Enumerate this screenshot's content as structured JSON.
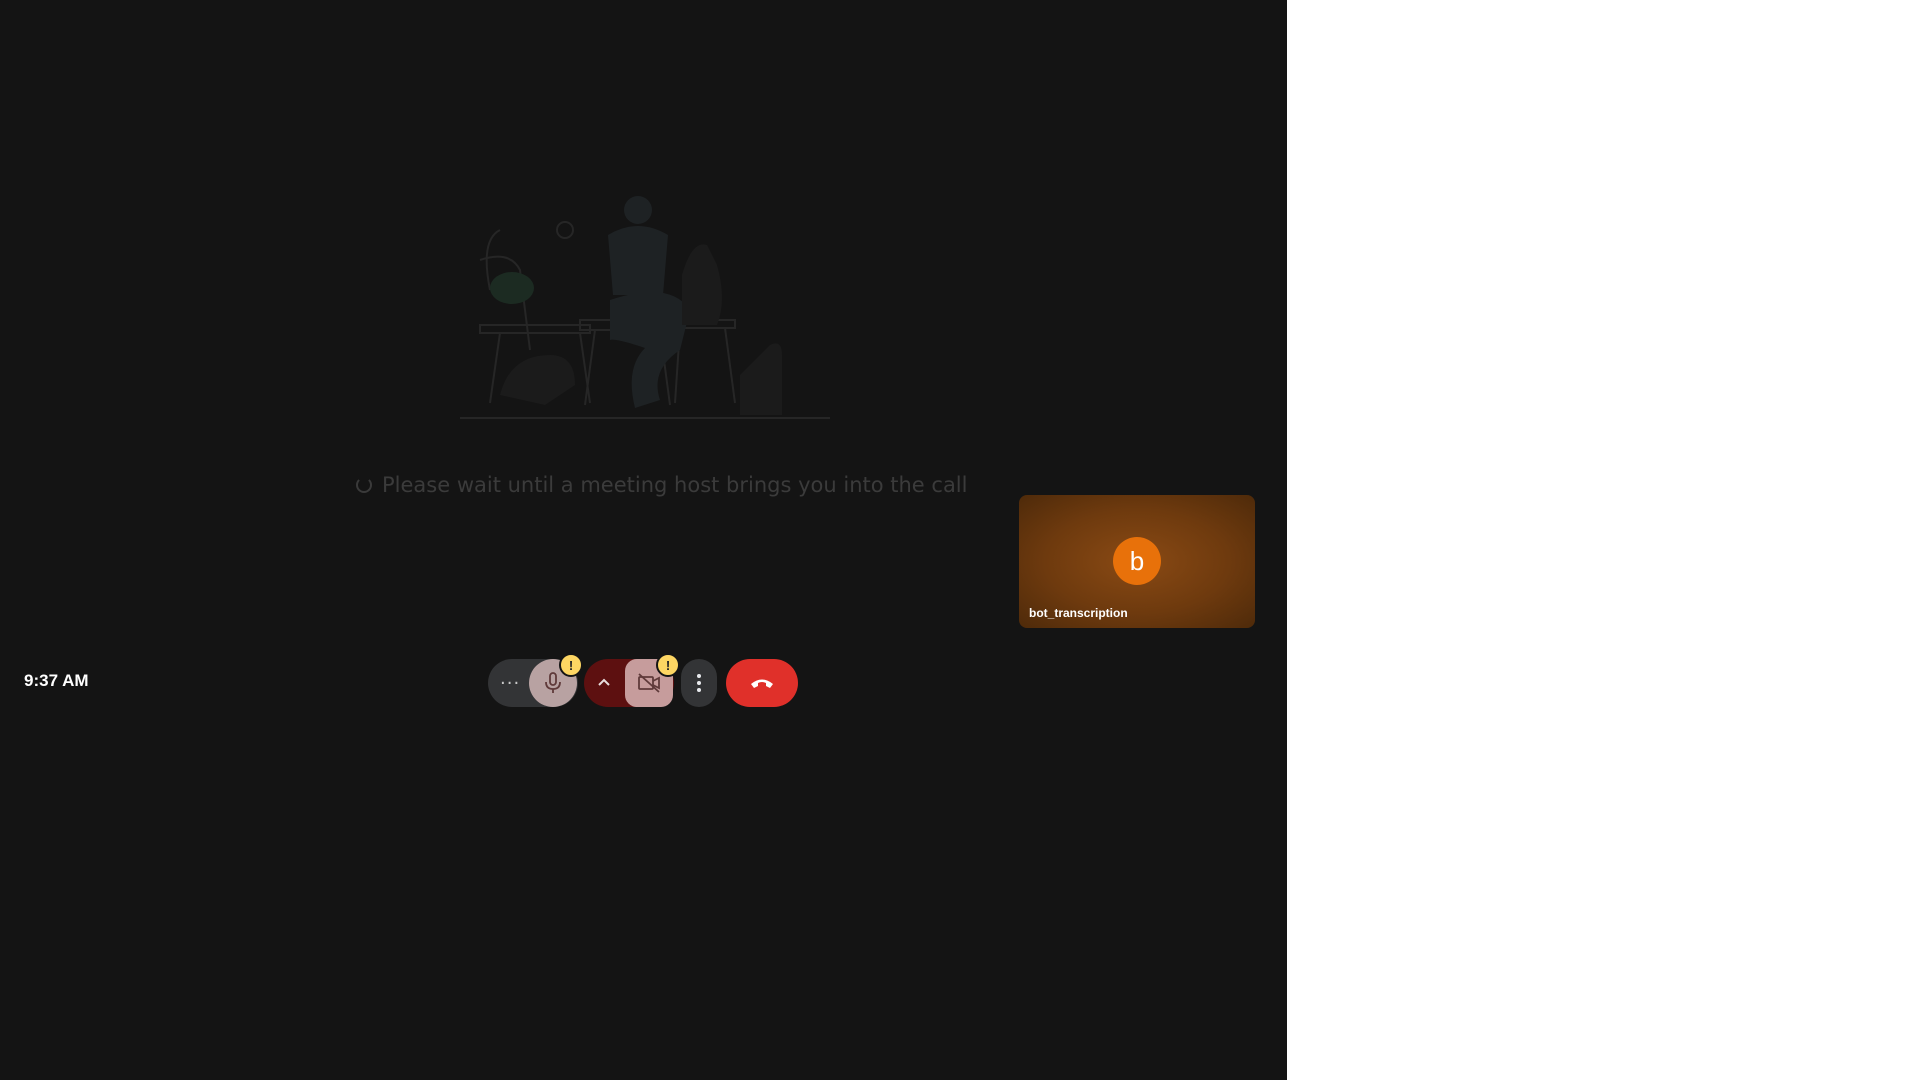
{
  "colors": {
    "stage_background": "#141414",
    "tile_avatar": "#e8710a",
    "hangup": "#e0302a",
    "warning_badge": "#fdd663"
  },
  "waiting": {
    "message": "Please wait until a meeting host brings you into the call"
  },
  "self_tile": {
    "avatar_letter": "b",
    "name": "bot_transcription"
  },
  "clock": {
    "time": "9:37 AM"
  },
  "controls": {
    "more_audio_glyph": "···",
    "mic_warning": "!",
    "camera_warning": "!",
    "icons": {
      "mic": "microphone-icon",
      "camera": "camera-off-icon",
      "options": "more-vert-icon",
      "hangup": "call-end-icon",
      "chevron": "chevron-up-icon"
    }
  }
}
